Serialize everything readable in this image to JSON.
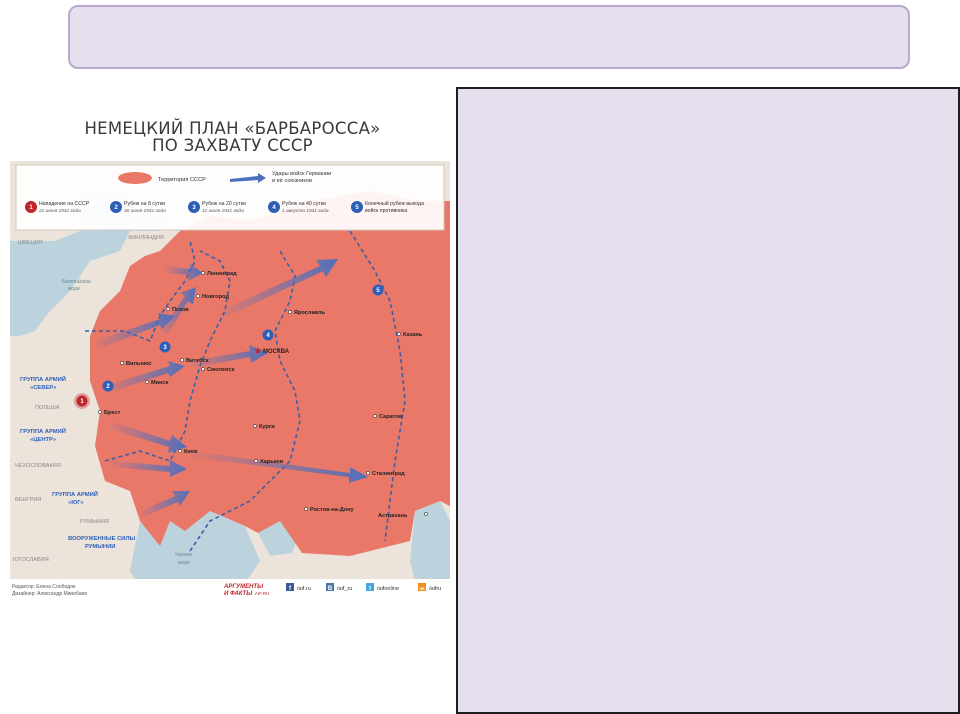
{
  "title_box": {
    "text": ""
  },
  "notes_box": {
    "text": ""
  },
  "map": {
    "title_line1": "НЕМЕЦКИЙ ПЛАН «БАРБАРОССА»",
    "title_line2": "ПО ЗАХВАТУ СССР",
    "legend": {
      "territory": "Территория СССР",
      "strikes_line1": "Удары войск Германии",
      "strikes_line2": "и её союзников",
      "items": [
        {
          "num": "1",
          "label": "Нападение на СССР",
          "date": "22 июня 1941 года"
        },
        {
          "num": "2",
          "label": "Рубеж на 8 сутки",
          "date": "30 июня 1941 года"
        },
        {
          "num": "3",
          "label": "Рубеж на 20 сутки",
          "date": "12 июля 1941 года"
        },
        {
          "num": "4",
          "label": "Рубеж на 40 сутки",
          "date": "1 августа 1941 года"
        },
        {
          "num": "5",
          "label": "Конечный рубеж выхода",
          "date": "войск противника"
        }
      ]
    },
    "countries": {
      "sweden": "ШВЕЦИЯ",
      "finland": "ФИНЛЯНДИЯ",
      "poland": "ПОЛЬША",
      "czech": "ЧЕХОСЛОВАКИЯ",
      "hungary": "ВЕНГРИЯ",
      "romania": "РУМЫНИЯ",
      "yugoslavia": "ЮГОСЛАВИЯ"
    },
    "seas": {
      "baltic_1": "Балтийское",
      "baltic_2": "море",
      "black_1": "Черное",
      "black_2": "море"
    },
    "groups": {
      "north_1": "ГРУППА АРМИЙ",
      "north_2": "«СЕВЕР»",
      "center_1": "ГРУППА АРМИЙ",
      "center_2": "«ЦЕНТР»",
      "south_1": "ГРУППА АРМИЙ",
      "south_2": "«ЮГ»",
      "romania_1": "ВООРУЖЕННЫЕ СИЛЫ",
      "romania_2": "РУМЫНИИ"
    },
    "cities": {
      "leningrad": "Ленинград",
      "novgorod": "Новгород",
      "pskov": "Псков",
      "yaroslavl": "Ярославль",
      "kazan": "Казань",
      "moscow": "МОСКВА",
      "vilnius": "Вильнюс",
      "vitebsk": "Витебск",
      "smolensk": "Смоленск",
      "minsk": "Минск",
      "brest": "Брест",
      "kursk": "Курск",
      "saratov": "Саратов",
      "kiev": "Киев",
      "kharkov": "Харьков",
      "stalingrad": "Сталинград",
      "rostov": "Ростов-на-Дону",
      "astrakhan": "Астрахань"
    },
    "markers": {
      "m1": "1",
      "m2": "2",
      "m3": "3",
      "m4": "4",
      "m5": "5"
    },
    "footer": {
      "editor": "Редактор: Елена Слободян",
      "designer": "Дизайнер: Александр Минибаев",
      "brand_line1": "АРГУМЕНТЫ",
      "brand_line2": "И ФАКТЫ",
      "brand_site": "AIF.RU",
      "fb": "/aif.ru",
      "vk": "/aif_ru",
      "tw": "/aifonline",
      "ok": "/aifru",
      "fb_icon": "f",
      "vk_icon": "B",
      "tw_icon": "t",
      "ok_icon": "ok"
    },
    "colors": {
      "ussr": "#e97868",
      "land": "#ece3db",
      "sea": "#bcd3de",
      "arrow": "#4a6fbf",
      "marker_blue": "#2d5fb8",
      "marker_red": "#c0272d"
    }
  }
}
